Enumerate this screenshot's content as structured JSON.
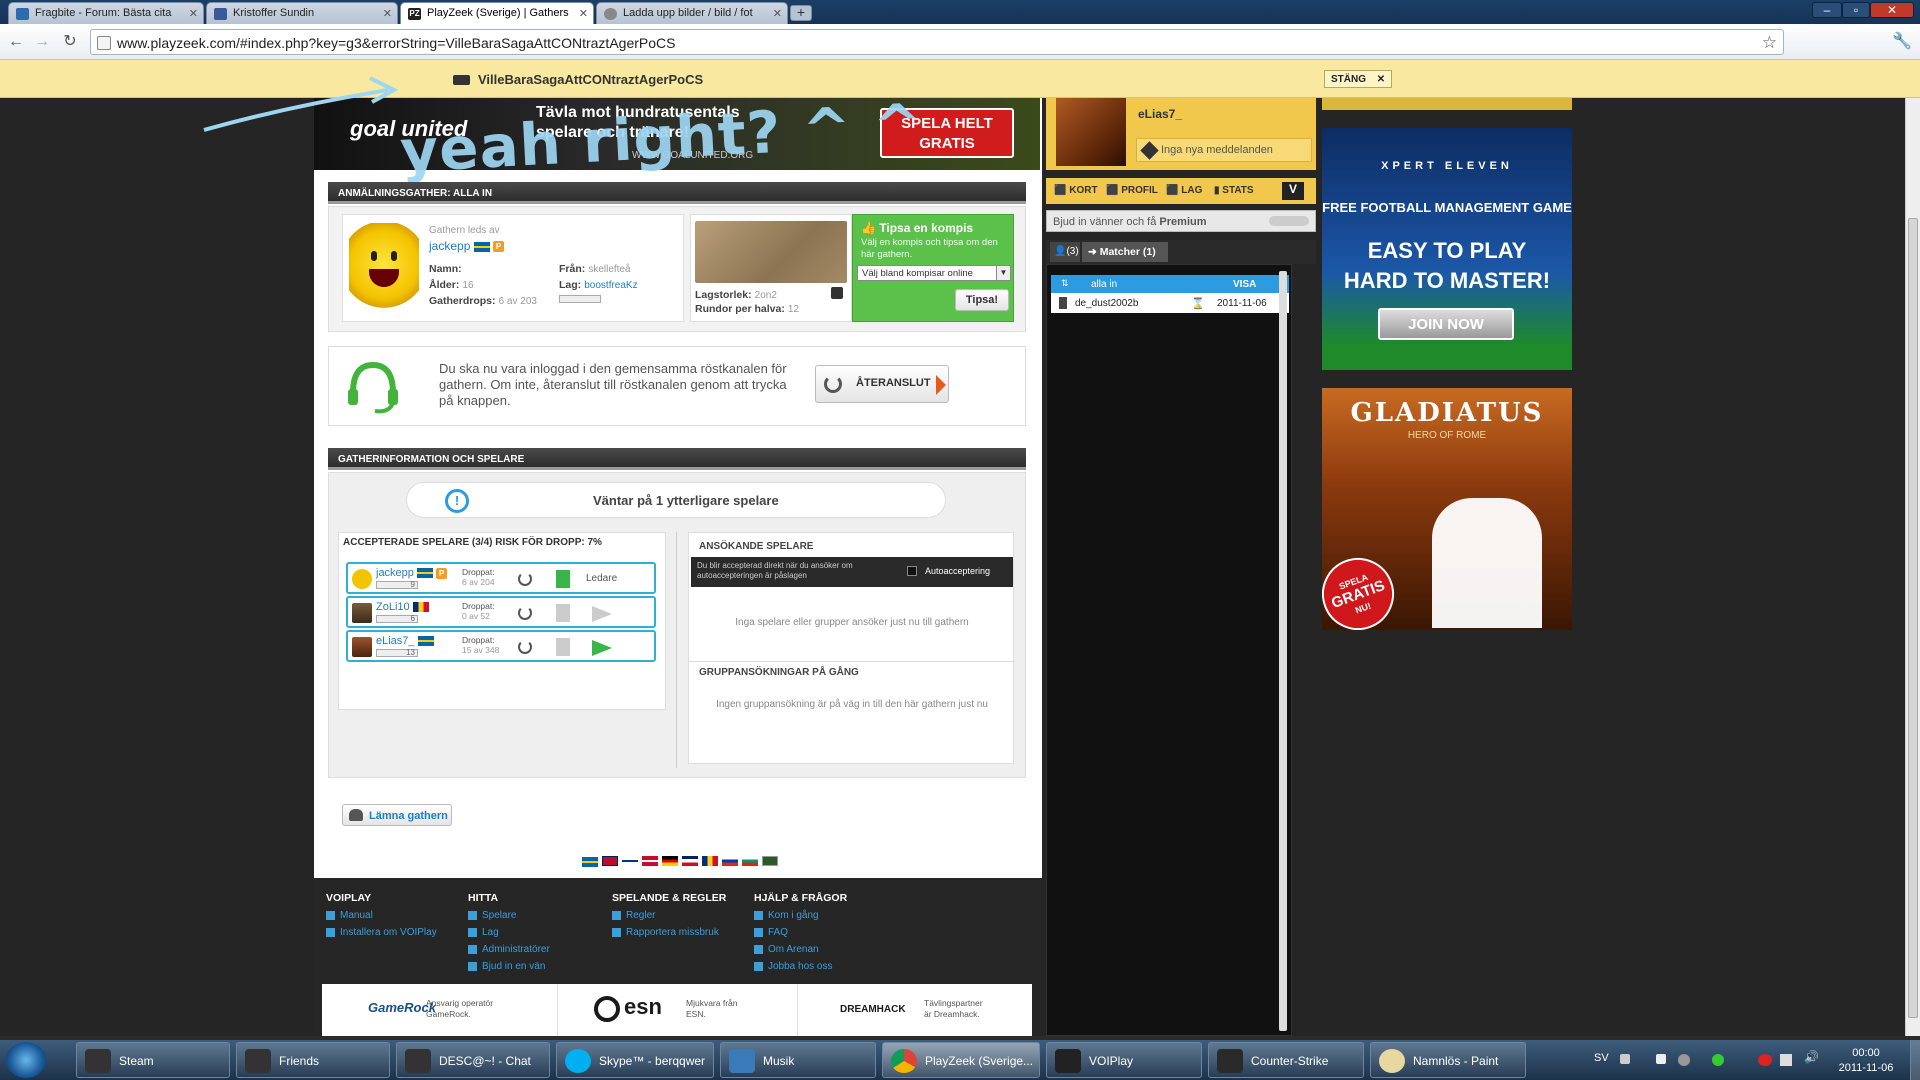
{
  "browser": {
    "tabs": [
      {
        "title": "Fragbite - Forum: Bästa cita",
        "fav": "#2d6bb0"
      },
      {
        "title": "Kristoffer Sundin",
        "fav": "#3b5998"
      },
      {
        "title": "PlayZeek (Sverige) | Gathers",
        "fav": "#222"
      },
      {
        "title": "Ladda upp bilder / bild / fot",
        "fav": "#888"
      }
    ],
    "url": "www.playzeek.com/#index.php?key=g3&errorString=VilleBaraSagaAttCONtraztAgerPoCS",
    "infobar_message": "VilleBaraSagaAttCONtraztAgerPoCS",
    "infobar_close": "STÄNG"
  },
  "banner": {
    "line1": "Tävla mot hundratusentals",
    "line2": "spelare och tränare!",
    "url": "WWW.GOALUNITED.ORG",
    "cta1": "SPELA HELT",
    "cta2": "GRATIS",
    "brand": "goal united",
    "overlay": "yeah right? ^ ^"
  },
  "gather": {
    "header": "ANMÄLNINGSGATHER: ALLA IN",
    "led_by_label": "Gathern leds av",
    "leader": "jackepp",
    "name_label": "Namn:",
    "age_label": "Ålder:",
    "age": "16",
    "drops_label": "Gatherdrops:",
    "drops": "6 av 203",
    "from_label": "Från:",
    "from": "skellefteå",
    "team_label": "Lag:",
    "team": "boostfreaKz",
    "team_size_label": "Lagstorlek:",
    "team_size": "2on2",
    "rounds_label": "Rundor per halva:",
    "rounds": "12",
    "tip_title": "Tipsa en kompis",
    "tip_text": "Välj en kompis och tipsa om den här gathern.",
    "tip_select": "Välj bland kompisar online",
    "tip_button": "Tipsa!"
  },
  "voice": {
    "text1": "Du ska nu vara inloggad i den gemensamma röstkanalen för",
    "text2": "gathern. Om inte, återanslut till röstkanalen genom att trycka",
    "text3": "på knappen.",
    "button": "ÅTERANSLUT"
  },
  "info": {
    "header": "GATHERINFORMATION OCH SPELARE",
    "waiting": "Väntar på 1 ytterligare spelare",
    "accepted_header": "ACCEPTERADE SPELARE (3/4) RISK FÖR DROPP: 7%",
    "players": [
      {
        "name": "jackepp",
        "drop_label": "Droppat:",
        "drops": "6 av 204",
        "role": "Ledare",
        "rank": "9"
      },
      {
        "name": "ZoLi10",
        "drop_label": "Droppat:",
        "drops": "0 av 52",
        "role": "",
        "rank": "6"
      },
      {
        "name": "eLias7_",
        "drop_label": "Droppat:",
        "drops": "15 av 348",
        "role": "",
        "rank": "13"
      }
    ],
    "applying_header": "ANSÖKANDE SPELARE",
    "auto_text1": "Du blir accepterad direkt när du ansöker om",
    "auto_text2": "autoaccepteringen är påslagen",
    "auto_label": "Autoacceptering",
    "no_applicants": "Inga spelare eller grupper ansöker just nu till gathern",
    "group_header": "GRUPPANSÖKNINGAR PÅ GÅNG",
    "no_groups": "Ingen gruppansökning är på väg in till den här gathern just nu",
    "leave": "Lämna gathern"
  },
  "footer": {
    "cols": [
      {
        "title": "VOIPLAY",
        "items": [
          "Manual",
          "Installera om VOIPlay"
        ]
      },
      {
        "title": "HITTA",
        "items": [
          "Spelare",
          "Lag",
          "Administratörer",
          "Bjud in en vän"
        ]
      },
      {
        "title": "SPELANDE & REGLER",
        "items": [
          "Regler",
          "Rapportera missbruk"
        ]
      },
      {
        "title": "HJÄLP & FRÅGOR",
        "items": [
          "Kom i gång",
          "FAQ",
          "Om Arenan",
          "Jobba hos oss"
        ]
      }
    ],
    "partners": [
      {
        "logo": "GameRock",
        "t1": "Ansvarig operatör",
        "t2": "GameRock."
      },
      {
        "logo": "esn",
        "t1": "Mjukvara från",
        "t2": "ESN."
      },
      {
        "logo": "DREAMHACK",
        "t1": "Tävlingspartner",
        "t2": "är Dreamhack."
      }
    ]
  },
  "profile": {
    "username": "eLias7_",
    "messages": "Inga nya meddelanden",
    "nav": [
      "KORT",
      "PROFIL",
      "LAG",
      "STATS"
    ],
    "premium_prefix": "Bjud in vänner och få",
    "premium": "Premium",
    "tab_friends": "(3)",
    "tab_matches": "Matcher (1)",
    "col_name": "alla in",
    "col_show": "VISA",
    "match_map": "de_dust2002b",
    "match_date": "2011-11-06"
  },
  "ads": {
    "xpert": {
      "brand": "XPERT ELEVEN",
      "tag": "FREE FOOTBALL MANAGEMENT GAME",
      "l1": "EASY TO PLAY",
      "l2": "HARD TO MASTER!",
      "btn": "JOIN NOW"
    },
    "glad": {
      "brand": "GLADIATUS",
      "tag": "HERO OF ROME",
      "s1": "SPELA",
      "s2": "GRATIS",
      "s3": "NU!"
    }
  },
  "taskbar": {
    "items": [
      "Steam",
      "Friends",
      "DESC@~! - Chat",
      "Skype™ - berqqwer",
      "Musik",
      "PlayZeek (Sverige...",
      "VOIPlay",
      "Counter-Strike",
      "Namnlös - Paint"
    ],
    "lang": "SV",
    "time": "00:00",
    "date": "2011-11-06"
  }
}
